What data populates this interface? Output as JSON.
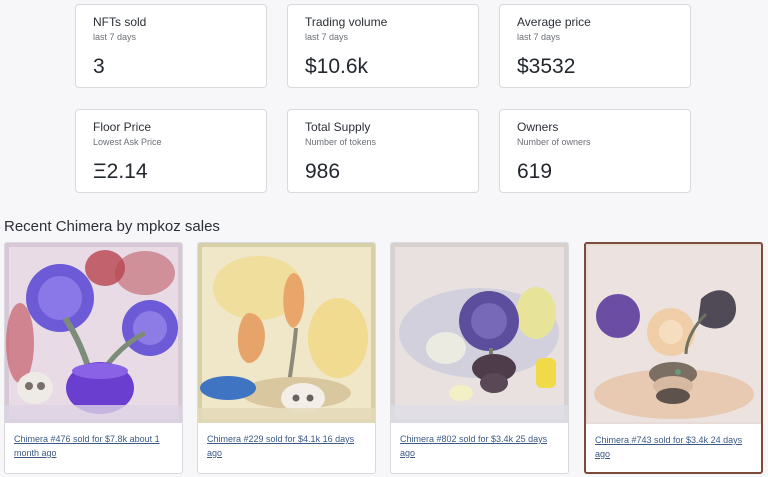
{
  "stats": [
    {
      "title": "NFTs sold",
      "subtitle": "last 7 days",
      "value": "3"
    },
    {
      "title": "Trading volume",
      "subtitle": "last 7 days",
      "value": "$10.6k"
    },
    {
      "title": "Average price",
      "subtitle": "last 7 days",
      "value": "$3532"
    },
    {
      "title": "Floor Price",
      "subtitle": "Lowest Ask Price",
      "value": "Ξ2.14"
    },
    {
      "title": "Total Supply",
      "subtitle": "Number of tokens",
      "value": "986"
    },
    {
      "title": "Owners",
      "subtitle": "Number of owners",
      "value": "619"
    }
  ],
  "recent_sales": {
    "heading": "Recent Chimera by mpkoz sales",
    "items": [
      {
        "link_text": "Chimera #476 sold for $7.8k about 1 month ago"
      },
      {
        "link_text": "Chimera #229 sold for $4.1k 16 days ago"
      },
      {
        "link_text": "Chimera #802 sold for $3.4k 25 days ago"
      },
      {
        "link_text": "Chimera #743 sold for $3.4k 24 days ago"
      }
    ]
  },
  "colors": {
    "background": "#f7f6f8",
    "card_border": "#d9d9de",
    "link": "#3c5a84"
  }
}
